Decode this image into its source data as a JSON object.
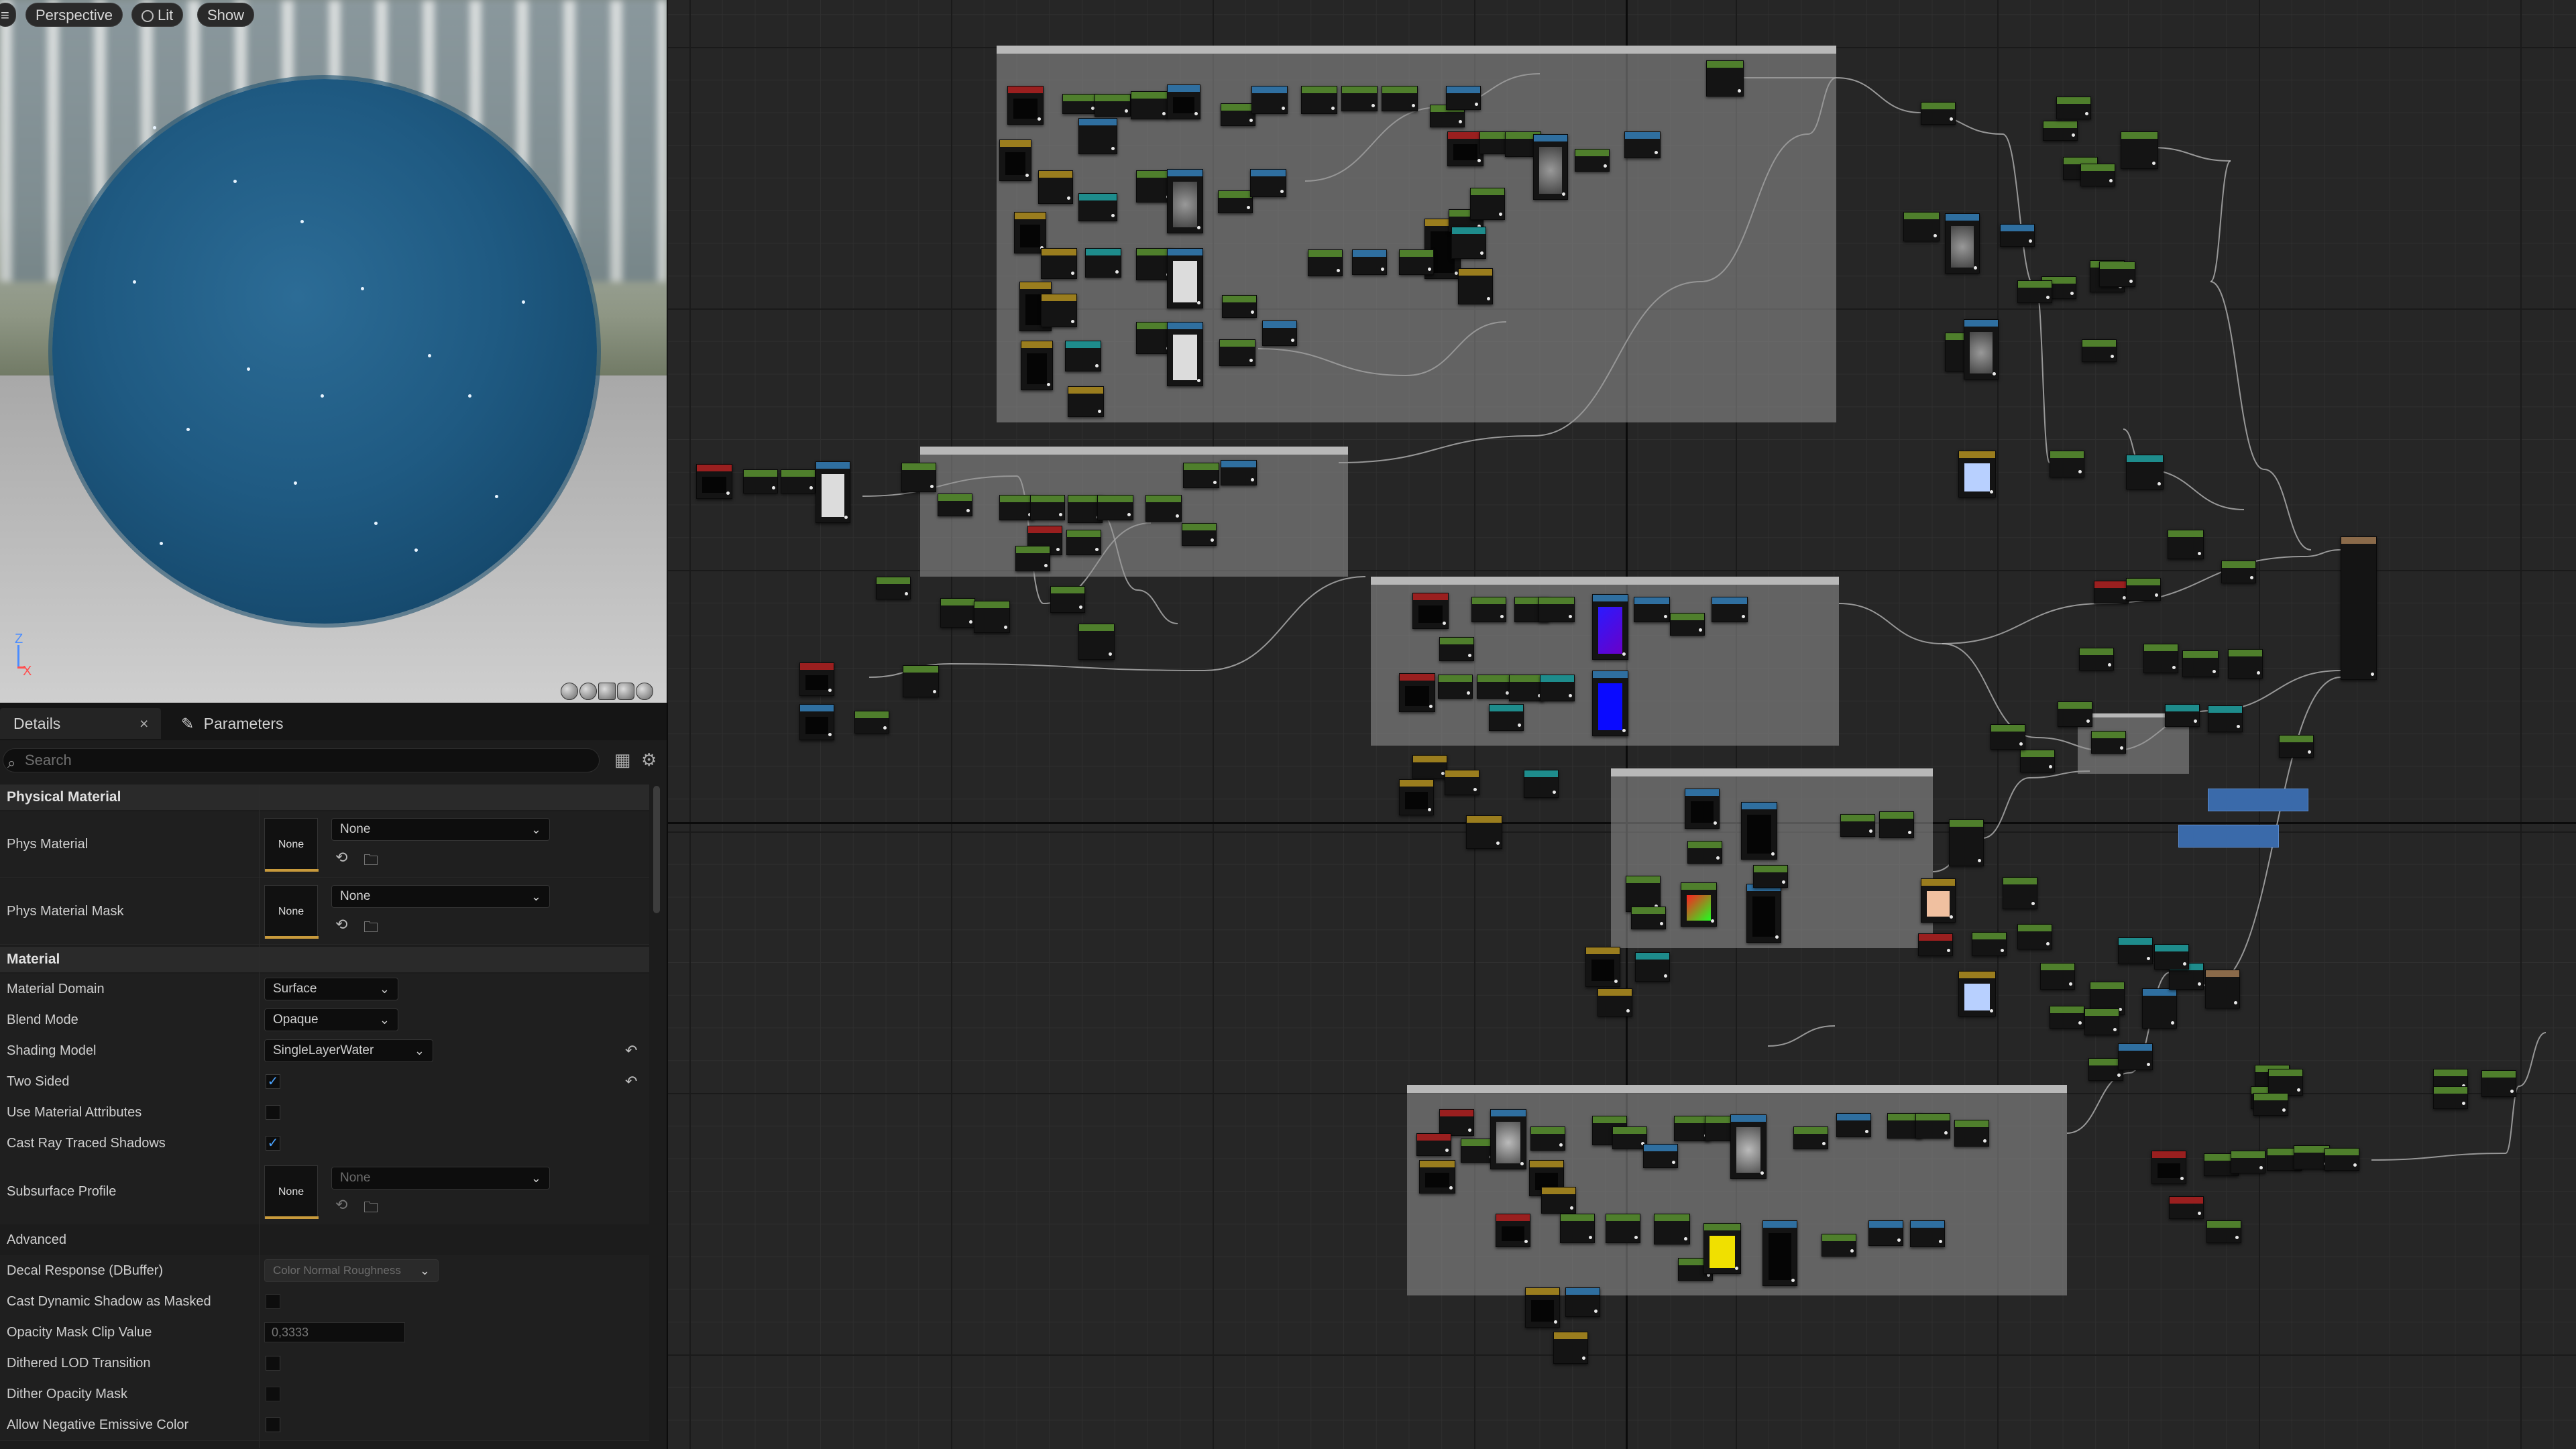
{
  "viewport": {
    "buttons": {
      "menu": "≡",
      "perspective": "Perspective",
      "lit": "Lit",
      "show": "Show"
    },
    "axes": {
      "z": "Z",
      "x": "X"
    },
    "preview_icons": [
      "sphere-preview-icon",
      "material-ball-icon",
      "cube-preview-icon",
      "cylinder-preview-icon",
      "gear-preview-icon"
    ]
  },
  "tabs": {
    "details": "Details",
    "close": "×",
    "parameters": "Parameters",
    "parameters_icon": "✎"
  },
  "search": {
    "placeholder": "Search",
    "icon": "⌕",
    "grid_icon": "▦",
    "gear_icon": "⚙"
  },
  "sections": {
    "physical_material": "Physical Material",
    "material": "Material",
    "advanced": "Advanced"
  },
  "properties": {
    "phys_material": {
      "label": "Phys Material",
      "thumb": "None",
      "value": "None"
    },
    "phys_material_mask": {
      "label": "Phys Material Mask",
      "thumb": "None",
      "value": "None"
    },
    "material_domain": {
      "label": "Material Domain",
      "value": "Surface"
    },
    "blend_mode": {
      "label": "Blend Mode",
      "value": "Opaque"
    },
    "shading_model": {
      "label": "Shading Model",
      "value": "SingleLayerWater"
    },
    "two_sided": {
      "label": "Two Sided",
      "checked": "✓"
    },
    "use_material_attributes": {
      "label": "Use Material Attributes",
      "checked": ""
    },
    "cast_ray_traced_shadows": {
      "label": "Cast Ray Traced Shadows",
      "checked": "✓"
    },
    "subsurface_profile": {
      "label": "Subsurface Profile",
      "thumb": "None",
      "value": "None"
    },
    "decal_response": {
      "label": "Decal Response (DBuffer)",
      "value": "Color Normal Roughness"
    },
    "cast_dynamic_shadow_as_masked": {
      "label": "Cast Dynamic Shadow as Masked",
      "checked": ""
    },
    "opacity_mask_clip_value": {
      "label": "Opacity Mask Clip Value",
      "value": "0,3333"
    },
    "dithered_lod_transition": {
      "label": "Dithered LOD Transition",
      "checked": ""
    },
    "dither_opacity_mask": {
      "label": "Dither Opacity Mask",
      "checked": ""
    },
    "allow_negative_emissive_color": {
      "label": "Allow Negative Emissive Color",
      "checked": ""
    }
  },
  "icons": {
    "chevron": "⌄",
    "reset": "↶",
    "browse": "⟲",
    "folder": "🗀"
  },
  "graph": {
    "header_colors": {
      "green": "#4f7f2c",
      "blue": "#2f6fa0",
      "red": "#9a1f1f",
      "yellow": "#9a7d1e",
      "teal": "#1e8c8c"
    },
    "comment_labels": [
      "",
      "",
      "",
      "",
      ""
    ],
    "label_nodes": [
      "",
      ""
    ]
  }
}
